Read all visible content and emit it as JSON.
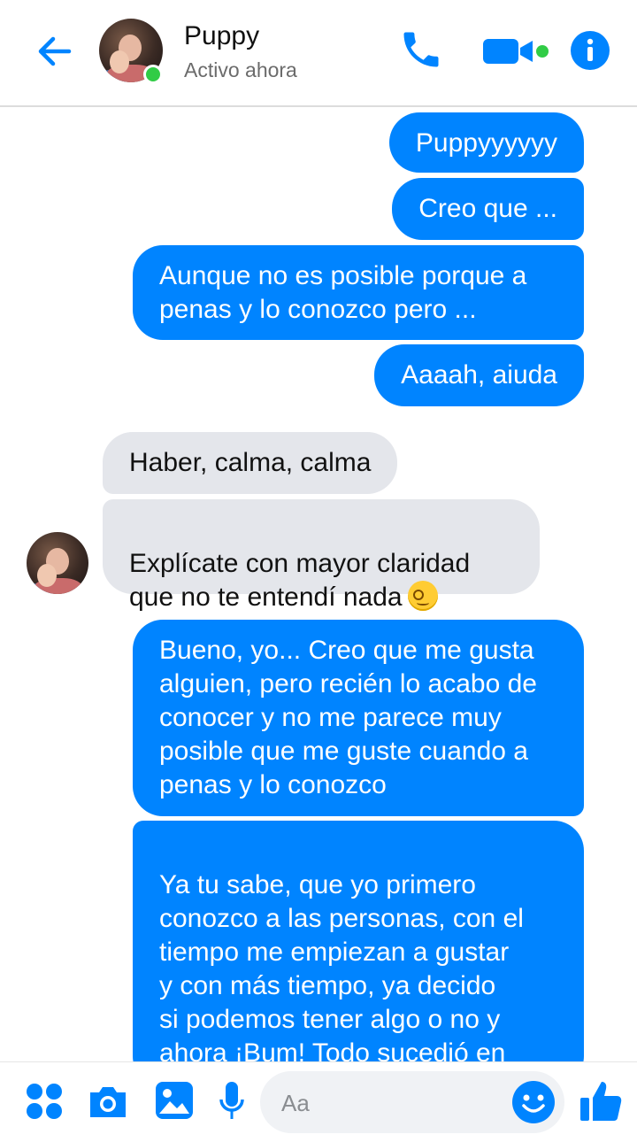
{
  "header": {
    "contact_name": "Puppy",
    "status": "Activo ahora",
    "icons": [
      "back-arrow-icon",
      "phone-icon",
      "video-camera-icon",
      "info-icon"
    ]
  },
  "messages": [
    {
      "side": "out",
      "text": "Puppyyyyyy"
    },
    {
      "side": "out",
      "text": "Creo que ..."
    },
    {
      "side": "out",
      "text": "Aunque no es posible porque a\npenas y lo conozco pero ..."
    },
    {
      "side": "out",
      "text": "Aaaah, aiuda"
    },
    {
      "side": "in",
      "text": "Haber, calma, calma"
    },
    {
      "side": "in",
      "text": "Explícate con mayor claridad\nque no te entendí nada",
      "emoji": "woozy-face"
    },
    {
      "side": "out",
      "text": "Bueno, yo... Creo que me gusta\nalguien, pero recién lo acabo de\nconocer y no me parece muy\nposible que me guste cuando a\npenas y lo conozco"
    },
    {
      "side": "out",
      "text": "Ya tu sabe, que yo primero\nconozco a las personas, con el\ntiempo me empiezan a gustar\ny con más tiempo, ya decido\nsi podemos tener algo o no y\nahora ¡Bum! Todo sucedió en\nun microsegundo",
      "emoji": "hushed-face"
    }
  ],
  "composer": {
    "placeholder": "Aa",
    "icons": [
      "apps-icon",
      "camera-icon",
      "gallery-icon",
      "microphone-icon",
      "emoji-icon",
      "thumbs-up-icon"
    ]
  },
  "colors": {
    "accent": "#0084ff",
    "incoming_bubble": "#e4e6eb",
    "online": "#31cc46"
  }
}
